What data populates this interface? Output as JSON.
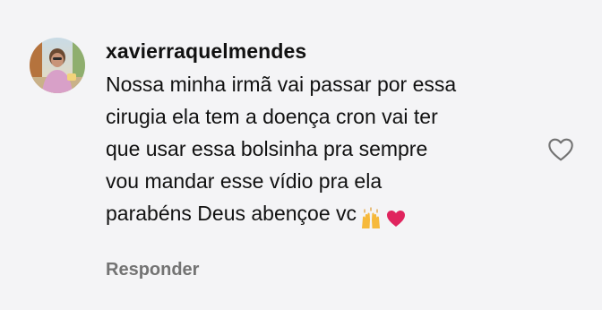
{
  "comment": {
    "username": "xavierraquelmendes",
    "text_lines": [
      "Nossa minha irmã vai passar por essa",
      "cirugia ela tem a doença cron vai ter",
      "que usar essa bolsinha pra sempre",
      "vou mandar esse vídio pra ela",
      "parabéns Deus abençoe vc"
    ],
    "emojis": [
      "🙌",
      "❤️"
    ],
    "reply_label": "Responder"
  },
  "icons": {
    "like": "heart-outline-icon",
    "avatar": "user-avatar"
  },
  "colors": {
    "background": "#f4f4f6",
    "text": "#111111",
    "secondary_text": "#737373",
    "heart": "#e0245e"
  }
}
